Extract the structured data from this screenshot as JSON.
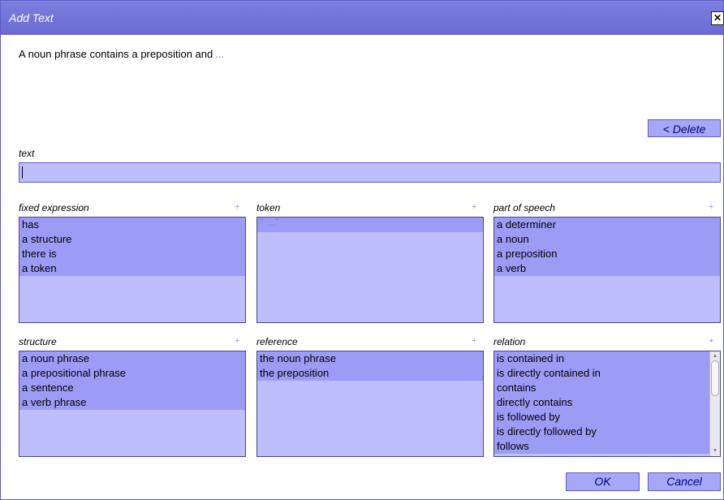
{
  "window": {
    "title": "Add Text",
    "close_icon": "close-icon"
  },
  "sentence": {
    "text": "A noun phrase contains a preposition and",
    "ellipsis": "..."
  },
  "delete_label": "< Delete",
  "text_field": {
    "label": "text",
    "value": ""
  },
  "plus_symbol": "+",
  "lists": {
    "fixed_expression": {
      "label": "fixed expression",
      "items": [
        "has",
        "a structure",
        "there is",
        "a token"
      ]
    },
    "token": {
      "label": "token",
      "items": [
        "\" ...\""
      ]
    },
    "part_of_speech": {
      "label": "part of speech",
      "items": [
        "a determiner",
        "a noun",
        "a preposition",
        "a verb"
      ]
    },
    "structure": {
      "label": "structure",
      "items": [
        "a noun phrase",
        "a prepositional phrase",
        "a sentence",
        "a verb phrase"
      ]
    },
    "reference": {
      "label": "reference",
      "items": [
        "the noun phrase",
        "the preposition"
      ]
    },
    "relation": {
      "label": "relation",
      "items": [
        "is contained in",
        "is directly contained in",
        "contains",
        "directly contains",
        "is followed by",
        "is directly followed by",
        "follows"
      ]
    }
  },
  "buttons": {
    "ok": "OK",
    "cancel": "Cancel"
  },
  "colors": {
    "titlebar": "#6a6ad2",
    "list_bg": "#bebefe",
    "list_item": "#9c9cf6",
    "button": "#a7a7f7"
  }
}
